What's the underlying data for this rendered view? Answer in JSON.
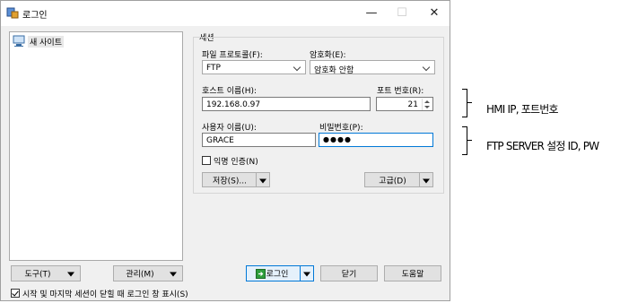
{
  "window": {
    "title": "로그인",
    "minimize_glyph": "—",
    "maximize_glyph": "☐",
    "close_glyph": "✕"
  },
  "site_list": {
    "items": [
      {
        "label": "새 사이트",
        "icon": "computer-icon"
      }
    ]
  },
  "session": {
    "group_label": "세션",
    "protocol": {
      "label": "파일 프로토콜(F):",
      "value": "FTP"
    },
    "encryption": {
      "label": "암호화(E):",
      "value": "암호화 안함"
    },
    "host": {
      "label": "호스트 이름(H):",
      "value": "192.168.0.97"
    },
    "port": {
      "label": "포트 번호(R):",
      "value": "21"
    },
    "username": {
      "label": "사용자 이름(U):",
      "value": "GRACE"
    },
    "password": {
      "label": "비밀번호(P):",
      "value": "●●●●"
    },
    "anonymous": {
      "label": "익명 인증(N)",
      "checked": false
    },
    "save_label": "저장(S)...",
    "advanced_label": "고급(D)"
  },
  "footer": {
    "tools_label": "도구(T)",
    "manage_label": "관리(M)",
    "login_label": "로그인",
    "close_label": "닫기",
    "help_label": "도움말",
    "show_on_startup": {
      "label": "시작 및 마지막 세션이 닫힐 때 로그인 창 표시(S)",
      "checked": true
    }
  },
  "annotations": {
    "host_note": "HMI IP, 포트번호",
    "login_note": "FTP SERVER 설정 ID, PW"
  },
  "colors": {
    "accent": "#0078d7",
    "login_icon": "#2e9e3c"
  }
}
